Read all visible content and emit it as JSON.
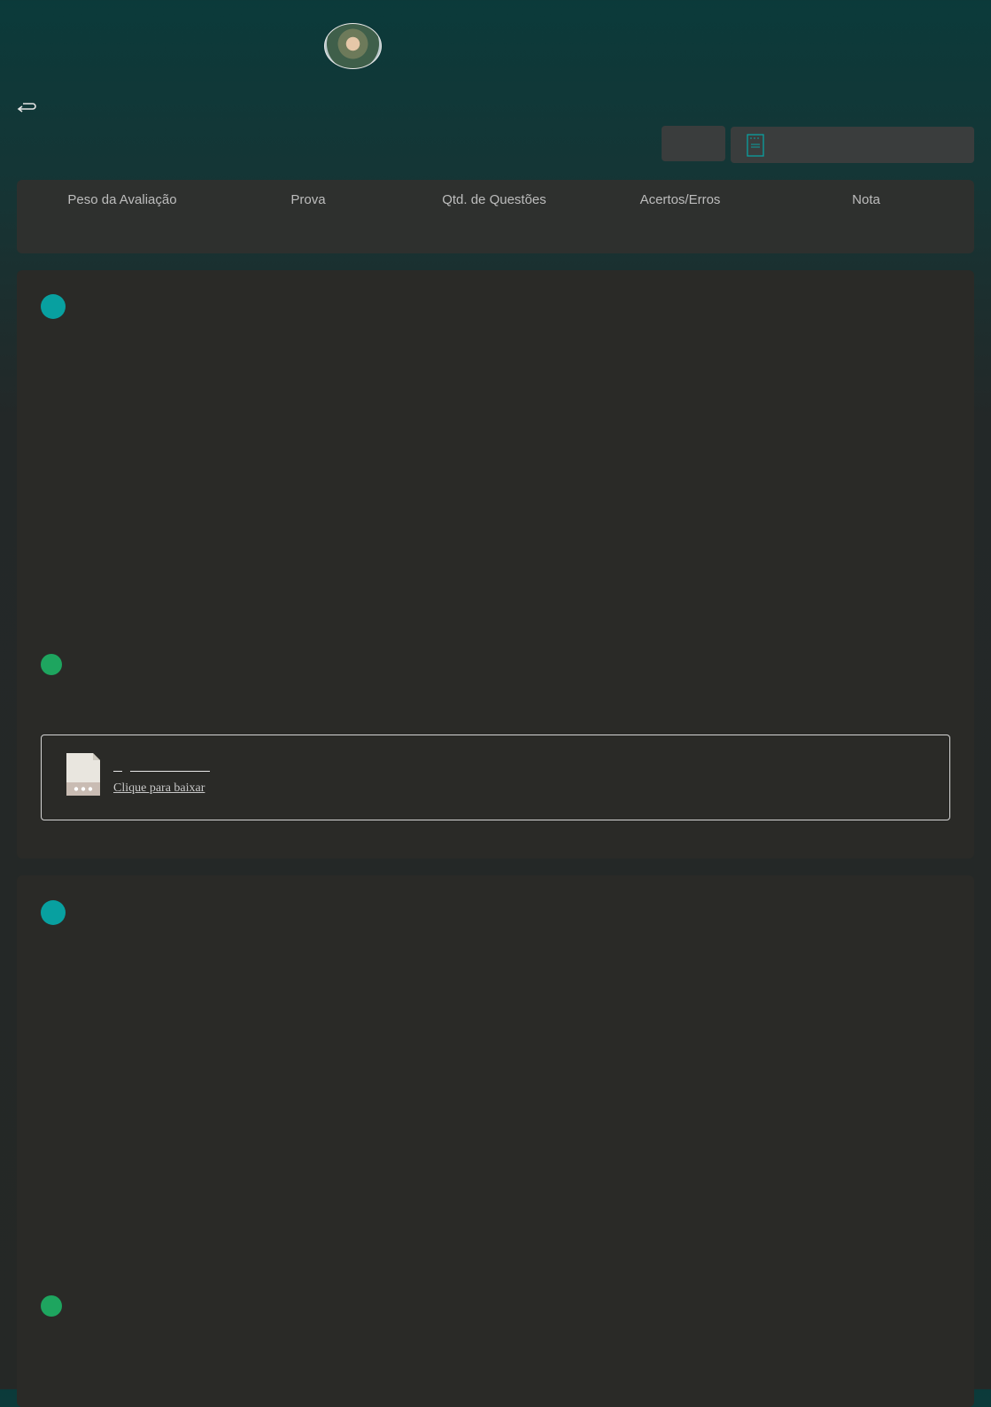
{
  "header": {
    "avatar_alt": "user-avatar",
    "back_icon": "return-arrow-icon"
  },
  "toolbar": {
    "small_button_icon": "",
    "doc_button_icon": "document-icon",
    "doc_button_label": ""
  },
  "summary": {
    "columns": [
      "Peso da Avaliação",
      "Prova",
      "Qtd. de Questões",
      "Acertos/Erros",
      "Nota"
    ]
  },
  "cards": [
    {
      "attachment": {
        "file_icon": "file-icon",
        "download_label": "Clique para baixar"
      }
    },
    {}
  ],
  "colors": {
    "accent_teal": "#08a0a0",
    "accent_green": "#1ea55f",
    "card_bg": "#2a2a27"
  }
}
